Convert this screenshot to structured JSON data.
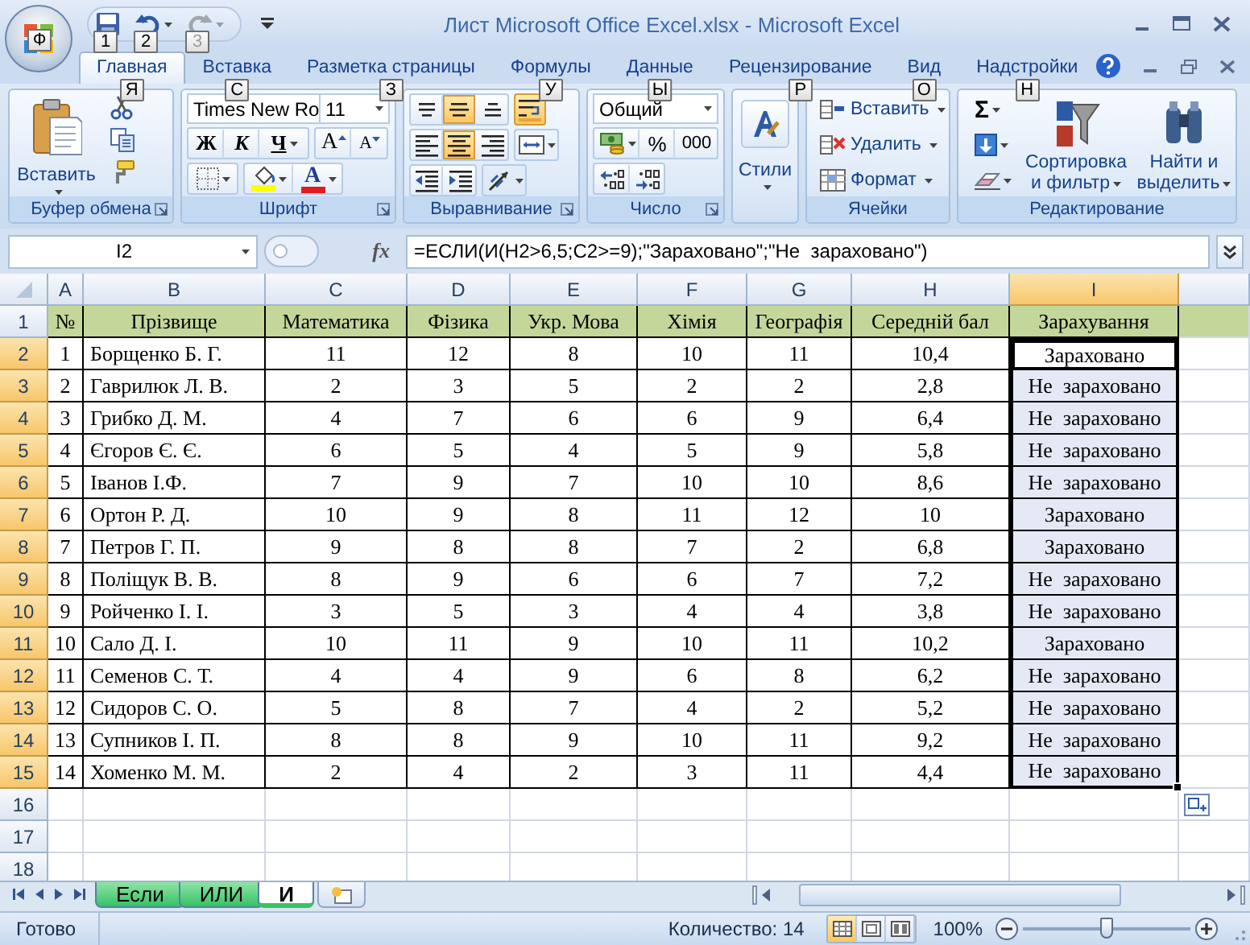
{
  "window": {
    "title": "Лист Microsoft Office Excel.xlsx - Microsoft Excel"
  },
  "office_button": {
    "keytip": "Ф"
  },
  "quick_access": [
    {
      "kind": "save",
      "keytip": "1",
      "disabled": false
    },
    {
      "kind": "undo",
      "keytip": "2",
      "disabled": false
    },
    {
      "kind": "redo",
      "keytip": "3",
      "disabled": true
    }
  ],
  "tabs": [
    {
      "label": "Главная",
      "selected": true,
      "keytip": "Я"
    },
    {
      "label": "Вставка",
      "selected": false,
      "keytip": "С"
    },
    {
      "label": "Разметка страницы",
      "selected": false,
      "keytip": "З"
    },
    {
      "label": "Формулы",
      "selected": false,
      "keytip": "У"
    },
    {
      "label": "Данные",
      "selected": false,
      "keytip": "Ы"
    },
    {
      "label": "Рецензирование",
      "selected": false,
      "keytip": "Р"
    },
    {
      "label": "Вид",
      "selected": false,
      "keytip": "О"
    },
    {
      "label": "Надстройки",
      "selected": false,
      "keytip": "Н"
    }
  ],
  "ribbon": {
    "clipboard": {
      "label": "Буфер обмена",
      "paste": "Вставить"
    },
    "font": {
      "label": "Шрифт",
      "font_name": "Times New Ro",
      "font_size": "11",
      "bold": "Ж",
      "italic": "К",
      "underline": "Ч",
      "grow": "A",
      "shrink": "A",
      "font_color": "A"
    },
    "alignment": {
      "label": "Выравнивание",
      "buttons": [
        {
          "kind": "top",
          "selected": false
        },
        {
          "kind": "middle",
          "selected": true
        },
        {
          "kind": "bottom",
          "selected": false
        },
        {
          "kind": "wrap",
          "selected": true
        },
        {
          "kind": "left",
          "selected": false
        },
        {
          "kind": "center",
          "selected": true
        },
        {
          "kind": "right",
          "selected": false
        },
        {
          "kind": "merge",
          "selected": false
        },
        {
          "kind": "outdent",
          "selected": false
        },
        {
          "kind": "indent",
          "selected": false
        },
        {
          "kind": "orientation",
          "selected": false
        }
      ]
    },
    "number": {
      "label": "Число",
      "format": "Общий",
      "percent": "%",
      "thousands": "000"
    },
    "styles": {
      "button": "Стили"
    },
    "cells": {
      "label": "Ячейки",
      "buttons": [
        {
          "kind": "insert",
          "label": "Вставить"
        },
        {
          "kind": "delete",
          "label": "Удалить"
        },
        {
          "kind": "format",
          "label": "Формат"
        }
      ]
    },
    "editing": {
      "label": "Редактирование",
      "sum": "Σ",
      "sort": [
        "Сортировка",
        "и фильтр"
      ],
      "find": [
        "Найти и",
        "выделить"
      ]
    }
  },
  "name_box": "I2",
  "fx": "fx",
  "formula": "=ЕСЛИ(И(H2>6,5;C2>=9);\"Зараховано\";\"Не  зараховано\")",
  "columns": [
    {
      "label": "A",
      "selected": false
    },
    {
      "label": "B",
      "selected": false
    },
    {
      "label": "C",
      "selected": false
    },
    {
      "label": "D",
      "selected": false
    },
    {
      "label": "E",
      "selected": false
    },
    {
      "label": "F",
      "selected": false
    },
    {
      "label": "G",
      "selected": false
    },
    {
      "label": "H",
      "selected": false
    },
    {
      "label": "I",
      "selected": true
    }
  ],
  "rows": [
    {
      "number": "1",
      "kind": "header",
      "selected": false,
      "active": false,
      "cells": [
        "№",
        "Прізвище",
        "Математика",
        "Фізика",
        "Укр. Мова",
        "Хімія",
        "Географія",
        "Середній бал",
        "Зарахування"
      ]
    },
    {
      "number": "2",
      "kind": "data",
      "selected": true,
      "active": true,
      "cells": [
        "1",
        "Борщенко Б. Г.",
        "11",
        "12",
        "8",
        "10",
        "11",
        "10,4",
        "Зараховано"
      ]
    },
    {
      "number": "3",
      "kind": "data",
      "selected": true,
      "active": false,
      "cells": [
        "2",
        "Гаврилюк Л. В.",
        "2",
        "3",
        "5",
        "2",
        "2",
        "2,8",
        "Не  зараховано"
      ]
    },
    {
      "number": "4",
      "kind": "data",
      "selected": true,
      "active": false,
      "cells": [
        "3",
        "Грибко Д. М.",
        "4",
        "7",
        "6",
        "6",
        "9",
        "6,4",
        "Не  зараховано"
      ]
    },
    {
      "number": "5",
      "kind": "data",
      "selected": true,
      "active": false,
      "cells": [
        "4",
        "Єгоров Є. Є.",
        "6",
        "5",
        "4",
        "5",
        "9",
        "5,8",
        "Не  зараховано"
      ]
    },
    {
      "number": "6",
      "kind": "data",
      "selected": true,
      "active": false,
      "cells": [
        "5",
        "Іванов І.Ф.",
        "7",
        "9",
        "7",
        "10",
        "10",
        "8,6",
        "Не  зараховано"
      ]
    },
    {
      "number": "7",
      "kind": "data",
      "selected": true,
      "active": false,
      "cells": [
        "6",
        "Ортон Р. Д.",
        "10",
        "9",
        "8",
        "11",
        "12",
        "10",
        "Зараховано"
      ]
    },
    {
      "number": "8",
      "kind": "data",
      "selected": true,
      "active": false,
      "cells": [
        "7",
        "Петров Г. П.",
        "9",
        "8",
        "8",
        "7",
        "2",
        "6,8",
        "Зараховано"
      ]
    },
    {
      "number": "9",
      "kind": "data",
      "selected": true,
      "active": false,
      "cells": [
        "8",
        "Поліщук В. В.",
        "8",
        "9",
        "6",
        "6",
        "7",
        "7,2",
        "Не  зараховано"
      ]
    },
    {
      "number": "10",
      "kind": "data",
      "selected": true,
      "active": false,
      "cells": [
        "9",
        "Ройченко І. І.",
        "3",
        "5",
        "3",
        "4",
        "4",
        "3,8",
        "Не  зараховано"
      ]
    },
    {
      "number": "11",
      "kind": "data",
      "selected": true,
      "active": false,
      "cells": [
        "10",
        "Сало Д. І.",
        "10",
        "11",
        "9",
        "10",
        "11",
        "10,2",
        "Зараховано"
      ]
    },
    {
      "number": "12",
      "kind": "data",
      "selected": true,
      "active": false,
      "cells": [
        "11",
        "Семенов С. Т.",
        "4",
        "4",
        "9",
        "6",
        "8",
        "6,2",
        "Не  зараховано"
      ]
    },
    {
      "number": "13",
      "kind": "data",
      "selected": true,
      "active": false,
      "cells": [
        "12",
        "Сидоров С. О.",
        "5",
        "8",
        "7",
        "4",
        "2",
        "5,2",
        "Не  зараховано"
      ]
    },
    {
      "number": "14",
      "kind": "data",
      "selected": true,
      "active": false,
      "cells": [
        "13",
        "Супников І. П.",
        "8",
        "8",
        "9",
        "10",
        "11",
        "9,2",
        "Не  зараховано"
      ]
    },
    {
      "number": "15",
      "kind": "data",
      "selected": true,
      "active": false,
      "cells": [
        "14",
        "Хоменко М. М.",
        "2",
        "4",
        "2",
        "3",
        "11",
        "4,4",
        "Не  зараховано"
      ]
    },
    {
      "number": "16",
      "kind": "empty",
      "selected": false,
      "active": false
    },
    {
      "number": "17",
      "kind": "empty",
      "selected": false,
      "active": false
    },
    {
      "number": "18",
      "kind": "empty",
      "selected": false,
      "active": false
    }
  ],
  "sheet_tabs": [
    {
      "label": "Если",
      "selected": false
    },
    {
      "label": "ИЛИ",
      "selected": false
    },
    {
      "label": "И",
      "selected": true
    }
  ],
  "status_bar": {
    "status": "Готово",
    "count": "Количество: 14",
    "views": [
      {
        "kind": "normal",
        "selected": true
      },
      {
        "kind": "layout",
        "selected": false
      },
      {
        "kind": "pagebreak",
        "selected": false
      }
    ],
    "zoom": "100%",
    "level": 0.5
  }
}
